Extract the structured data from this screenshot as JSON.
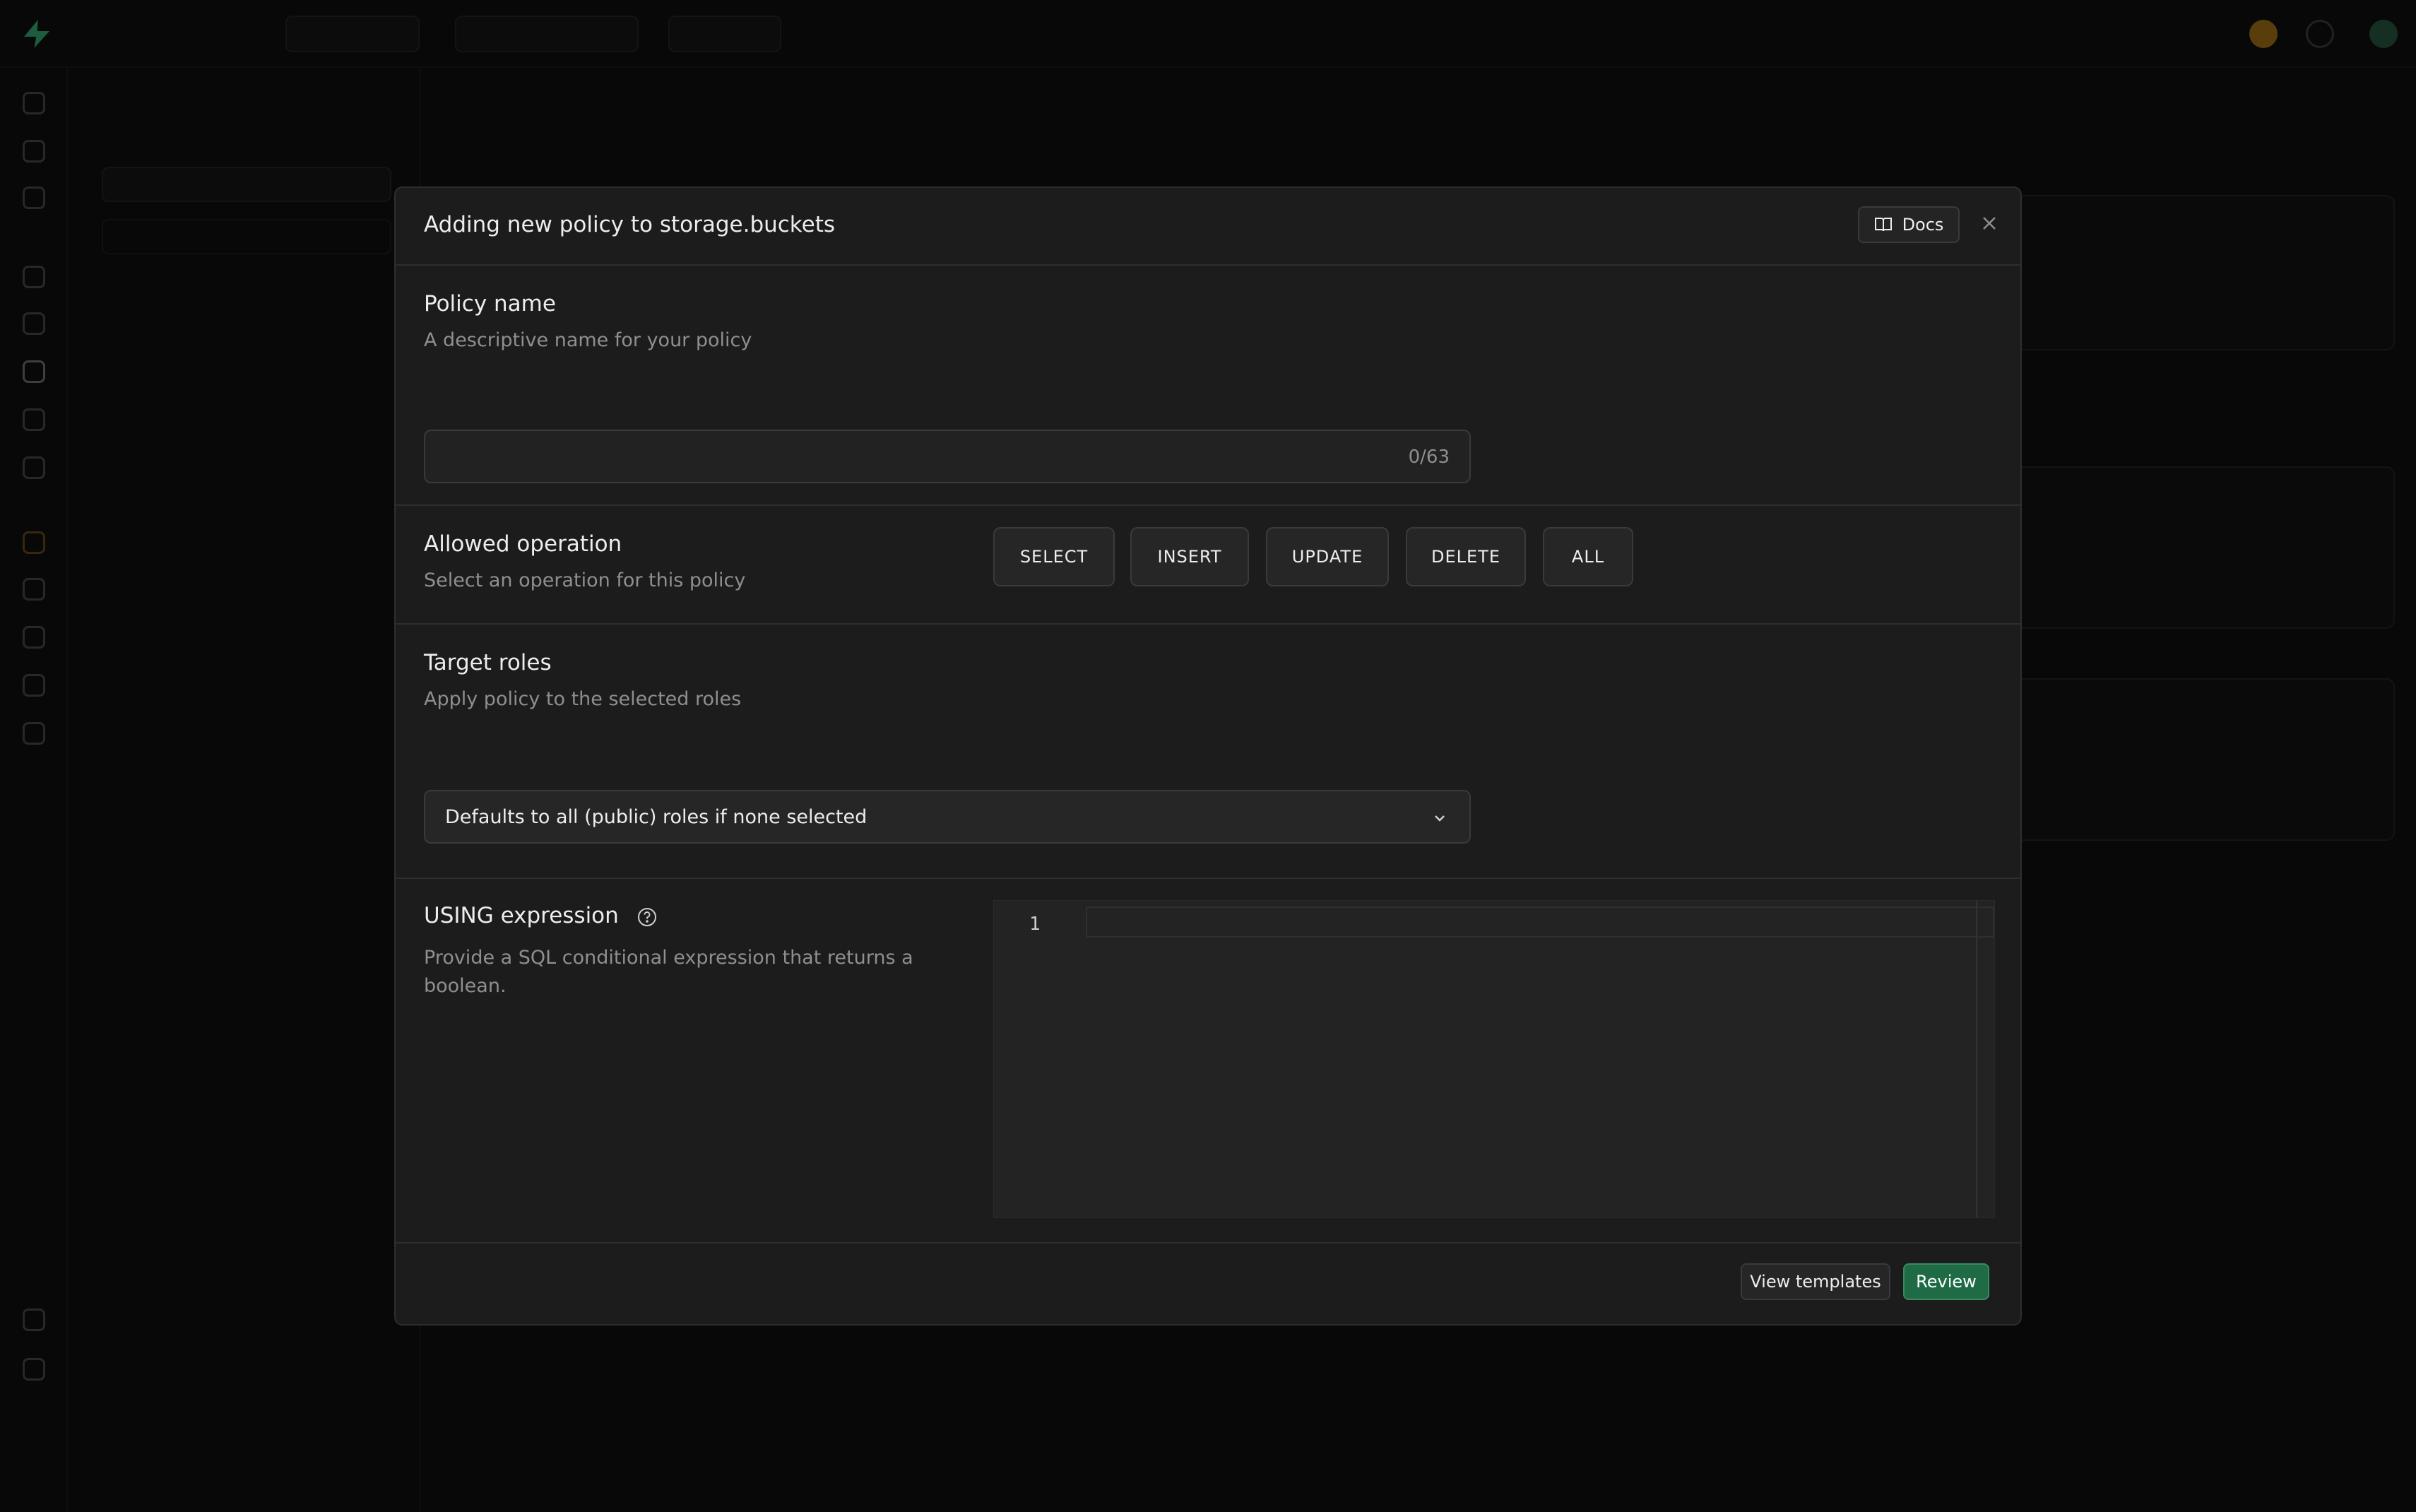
{
  "modal": {
    "title": "Adding new policy to storage.buckets",
    "docs_label": "Docs",
    "close_icon": "close-icon",
    "policy_name": {
      "label": "Policy name",
      "help": "A descriptive name for your policy",
      "value": "",
      "counter": "0/63"
    },
    "allowed_operation": {
      "label": "Allowed operation",
      "help": "Select an operation for this policy",
      "options": [
        "SELECT",
        "INSERT",
        "UPDATE",
        "DELETE",
        "ALL"
      ]
    },
    "target_roles": {
      "label": "Target roles",
      "help": "Apply policy to the selected roles",
      "selected": "Defaults to all (public) roles if none selected"
    },
    "using_expression": {
      "label": "USING expression",
      "help": "Provide a SQL conditional expression that returns a boolean.",
      "line_number": "1"
    },
    "footer": {
      "view_templates_label": "View templates",
      "review_label": "Review"
    }
  },
  "colors": {
    "accent": "#3ecf8e",
    "primary_button": "#1f6b45",
    "modal_bg": "#1c1c1c"
  }
}
